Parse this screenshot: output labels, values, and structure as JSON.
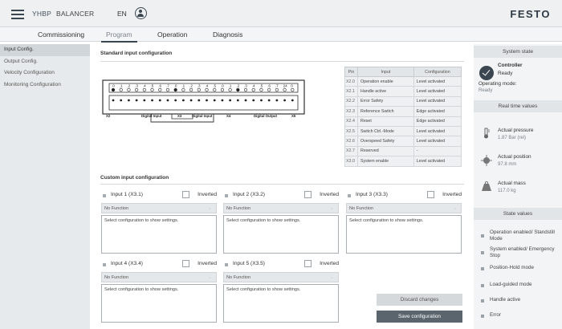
{
  "header": {
    "app_name": "YHBP",
    "app_subtitle": "BALANCER",
    "language": "EN",
    "logo": "FESTO"
  },
  "tabs": [
    {
      "label": "Commissioning",
      "active": false
    },
    {
      "label": "Program",
      "active": true
    },
    {
      "label": "Operation",
      "active": false
    },
    {
      "label": "Diagnosis",
      "active": false
    }
  ],
  "sidebar": {
    "items": [
      {
        "label": "Input Config.",
        "active": true
      },
      {
        "label": "Output Config.",
        "active": false
      },
      {
        "label": "Velocity Configuration",
        "active": false
      },
      {
        "label": "Monitoring Configuration",
        "active": false
      }
    ]
  },
  "standard": {
    "title": "Standard input configuration",
    "device": {
      "top_row_numbers": [
        ".0",
        ".1",
        ".2",
        ".3",
        ".4",
        ".5",
        ".6",
        ".7",
        ".0",
        ".1",
        ".2",
        ".3",
        ".4",
        ".5",
        ".0",
        ".1",
        ".2",
        ".3",
        ".4",
        ".5",
        ".6",
        ".7",
        "24",
        "0"
      ],
      "labels": [
        "X2",
        "Digital Input",
        "X3",
        "Digital Input",
        "X4",
        "Digital Output",
        "X5"
      ]
    },
    "table": {
      "headers": [
        "Pin",
        "Input",
        "Configuration"
      ],
      "rows": [
        [
          "X2.0",
          "Operation enable",
          "Level activated"
        ],
        [
          "X2.1",
          "Handle active",
          "Level activated"
        ],
        [
          "X2.2",
          "Error Safety",
          "Level activated"
        ],
        [
          "X2.3",
          "Reference Switch",
          "Edge activated"
        ],
        [
          "X2.4",
          "Reset",
          "Edge activated"
        ],
        [
          "X2.5",
          "Switch Ctrl.-Mode",
          "Level activated"
        ],
        [
          "X2.6",
          "Overspeed Safety",
          "Level activated"
        ],
        [
          "X2.7",
          "Reserved",
          "-"
        ],
        [
          "X3.0",
          "System enable",
          "Level activated"
        ]
      ]
    }
  },
  "custom": {
    "title": "Custom input configuration",
    "inverted_label": "Inverted",
    "inputs": [
      {
        "label": "Input 1 (X3.1)",
        "function": "No Function",
        "settings": "Select configuration to show settings."
      },
      {
        "label": "Input 2 (X3.2)",
        "function": "No Function",
        "settings": "Select configuration to show settings."
      },
      {
        "label": "Input 3 (X3.3)",
        "function": "No Function",
        "settings": "Select configuration to show settings."
      },
      {
        "label": "Input 4 (X3.4)",
        "function": "No Function",
        "settings": "Select configuration to show settings."
      },
      {
        "label": "Input 5 (X3.5)",
        "function": "No Function",
        "settings": "Select configuration to show settings."
      }
    ],
    "discard_label": "Discard changes",
    "save_label": "Save configuration"
  },
  "system_state": {
    "header": "System state",
    "controller_label": "Controller",
    "controller_status": "Ready",
    "operating_mode_label": "Operating mode:",
    "operating_mode_value": "Ready"
  },
  "realtime": {
    "header": "Real time values",
    "items": [
      {
        "label": "Actual pressure",
        "value": "1.87 Bar (rel)",
        "icon": "thermometer-icon"
      },
      {
        "label": "Actual position",
        "value": "97.8 mm",
        "icon": "position-icon"
      },
      {
        "label": "Actual mass",
        "value": "117.0 kg",
        "icon": "weight-icon"
      }
    ]
  },
  "state_values": {
    "header": "State values",
    "items": [
      "Operation enabled/ Standstill Mode",
      "System enabled/ Emergency Stop",
      "Position-Hold mode",
      "Load-guided mode",
      "Handle active",
      "Error"
    ]
  }
}
